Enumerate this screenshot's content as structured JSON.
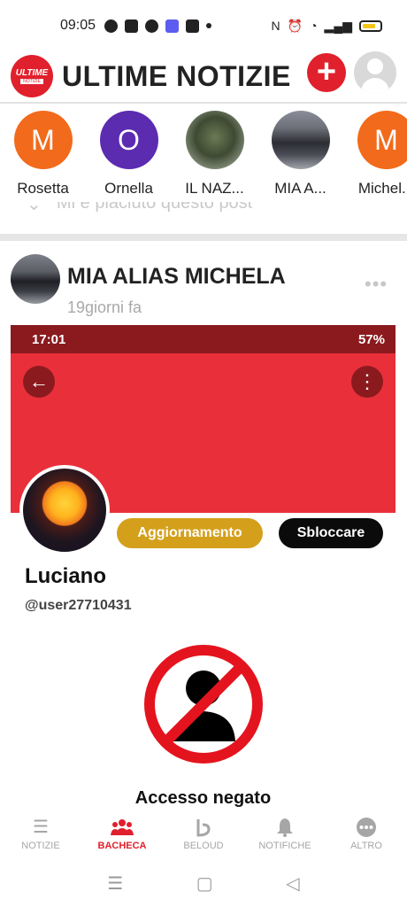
{
  "status_bar": {
    "time": "09:05"
  },
  "app": {
    "title": "ULTIME NOTIZIE",
    "logo_text": "ULTIME",
    "logo_sub": "NOTIZIE",
    "add_symbol": "+"
  },
  "stories": [
    {
      "initial": "M",
      "name": "Rosetta",
      "color": "#f26a1b"
    },
    {
      "initial": "O",
      "name": "Ornella",
      "color": "#5b2bb0"
    },
    {
      "initial": "",
      "name": "IL NAZ...",
      "color": ""
    },
    {
      "initial": "",
      "name": "MIA A...",
      "color": ""
    },
    {
      "initial": "M",
      "name": "Michel...",
      "color": "#f26a1b"
    }
  ],
  "ghost_row": {
    "text": "Mi e piaciuto questo post"
  },
  "post": {
    "author": "MIA ALIAS MICHELA",
    "time": "19giorni fa",
    "more": "•••"
  },
  "screenshot": {
    "status_time": "17:01",
    "battery": "57%",
    "back_icon": "←",
    "menu_icon": "⋮",
    "update_button": "Aggiornamento",
    "unblock_button": "Sbloccare",
    "name": "Luciano",
    "username": "@user27710431",
    "denied_text": "Accesso negato"
  },
  "bottom_nav": [
    {
      "label": "NOTIZIE",
      "icon": "list-icon"
    },
    {
      "label": "BACHECA",
      "icon": "people-icon",
      "active": true
    },
    {
      "label": "BELOUD",
      "icon": "beloud-icon"
    },
    {
      "label": "NOTIFICHE",
      "icon": "bell-icon"
    },
    {
      "label": "ALTRO",
      "icon": "more-icon"
    }
  ],
  "colors": {
    "accent": "#e0202c",
    "gold": "#d4a01c",
    "header_red": "#e9303a",
    "dark_red": "#8b1a1f"
  }
}
